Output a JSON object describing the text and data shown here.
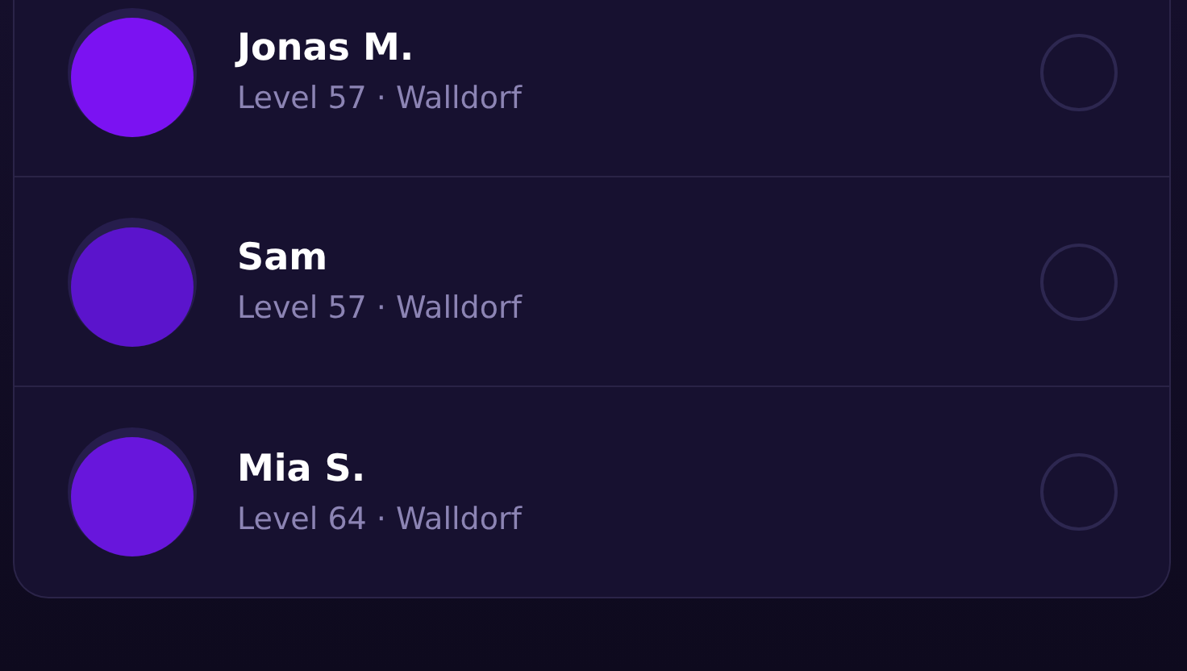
{
  "players": [
    {
      "name": "Jonas M.",
      "detail": "Level 57 · Walldorf",
      "color": "#7b12f2",
      "selected": false
    },
    {
      "name": "Sam",
      "detail": "Level 57 · Walldorf",
      "color": "#5b14cc",
      "selected": false
    },
    {
      "name": "Mia S.",
      "detail": "Level 64 · Walldorf",
      "color": "#6816dc",
      "selected": false
    }
  ]
}
